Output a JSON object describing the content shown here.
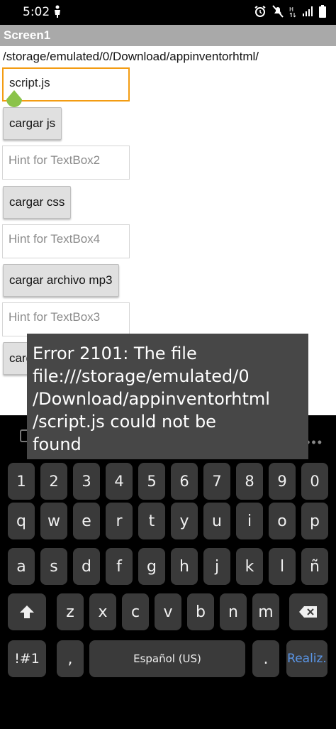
{
  "status_bar": {
    "time": "5:02",
    "icons": [
      "person-icon",
      "alarm-icon",
      "mute-icon",
      "data-icon",
      "signal-icon",
      "battery-icon"
    ]
  },
  "app": {
    "title": "Screen1",
    "path": "/storage/emulated/0/Download/appinventorhtml/"
  },
  "form": {
    "textbox1": {
      "value": "script.js"
    },
    "button_js": "cargar js",
    "textbox2": {
      "placeholder": "Hint for TextBox2"
    },
    "button_css": "cargar css",
    "textbox4": {
      "placeholder": "Hint for TextBox4"
    },
    "button_mp3": "cargar archivo mp3",
    "textbox3": {
      "placeholder": "Hint for TextBox3"
    },
    "button_partial": "carg"
  },
  "toast": {
    "message": "Error 2101: The file\nfile:///storage/emulated/0\n/Download/appinventorhtml\n/script.js could not be\nfound"
  },
  "keyboard": {
    "row_numbers": [
      "1",
      "2",
      "3",
      "4",
      "5",
      "6",
      "7",
      "8",
      "9",
      "0"
    ],
    "row_1": [
      "q",
      "w",
      "e",
      "r",
      "t",
      "y",
      "u",
      "i",
      "o",
      "p"
    ],
    "row_2": [
      "a",
      "s",
      "d",
      "f",
      "g",
      "h",
      "j",
      "k",
      "l",
      "ñ"
    ],
    "row_3": [
      "z",
      "x",
      "c",
      "v",
      "b",
      "n",
      "m"
    ],
    "symbols_key": "!#1",
    "comma_key": ",",
    "space_label": "Español (US)",
    "period_key": ".",
    "enter_label": "Realiz.",
    "colors": {
      "key_bg": "#3a3a3a",
      "enter_text": "#5a96e8",
      "board_bg": "#000000"
    }
  },
  "colors": {
    "title_bar": "#a9a9a9",
    "focus_border": "#f39c12",
    "handle": "#8bc34a",
    "toast_bg": "#474747"
  }
}
